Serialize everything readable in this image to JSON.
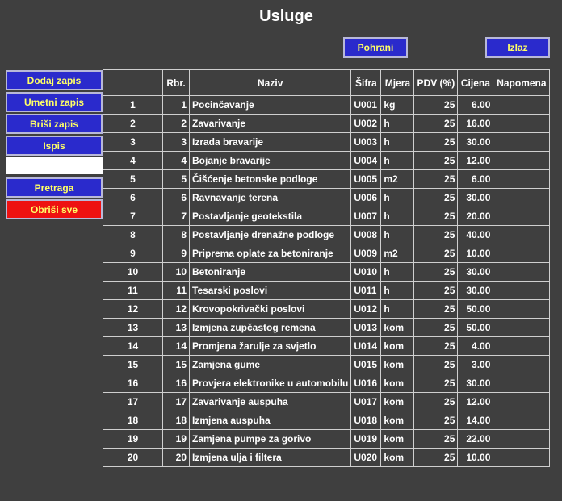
{
  "page": {
    "title": "Usluge"
  },
  "toolbar": {
    "save_label": "Pohrani",
    "exit_label": "Izlaz"
  },
  "sidebar": {
    "add_label": "Dodaj zapis",
    "insert_label": "Umetni zapis",
    "delete_label": "Briši zapis",
    "print_label": "Ispis",
    "search_value": "",
    "search_label": "Pretraga",
    "delete_all_label": "Obriši sve"
  },
  "colors": {
    "button_bg": "#2a2acc",
    "button_text": "#ffff66",
    "danger_bg": "#ee1111",
    "background": "#3f3f3f"
  },
  "table": {
    "headers": [
      "",
      "Rbr.",
      "Naziv",
      "Šifra",
      "Mjera",
      "PDV (%)",
      "Cijena",
      "Napomena"
    ],
    "rows": [
      [
        "1",
        "1",
        "Pocinčavanje",
        "U001",
        "kg",
        "25",
        "6.00",
        ""
      ],
      [
        "2",
        "2",
        "Zavarivanje",
        "U002",
        "h",
        "25",
        "16.00",
        ""
      ],
      [
        "3",
        "3",
        "Izrada bravarije",
        "U003",
        "h",
        "25",
        "30.00",
        ""
      ],
      [
        "4",
        "4",
        "Bojanje bravarije",
        "U004",
        "h",
        "25",
        "12.00",
        ""
      ],
      [
        "5",
        "5",
        "Čišćenje betonske podloge",
        "U005",
        "m2",
        "25",
        "6.00",
        ""
      ],
      [
        "6",
        "6",
        "Ravnavanje terena",
        "U006",
        "h",
        "25",
        "30.00",
        ""
      ],
      [
        "7",
        "7",
        "Postavljanje geotekstila",
        "U007",
        "h",
        "25",
        "20.00",
        ""
      ],
      [
        "8",
        "8",
        "Postavljanje drenažne podloge",
        "U008",
        "h",
        "25",
        "40.00",
        ""
      ],
      [
        "9",
        "9",
        "Priprema oplate za betoniranje",
        "U009",
        "m2",
        "25",
        "10.00",
        ""
      ],
      [
        "10",
        "10",
        "Betoniranje",
        "U010",
        "h",
        "25",
        "30.00",
        ""
      ],
      [
        "11",
        "11",
        "Tesarski poslovi",
        "U011",
        "h",
        "25",
        "30.00",
        ""
      ],
      [
        "12",
        "12",
        "Krovopokrivački poslovi",
        "U012",
        "h",
        "25",
        "50.00",
        ""
      ],
      [
        "13",
        "13",
        "Izmjena zupčastog remena",
        "U013",
        "kom",
        "25",
        "50.00",
        ""
      ],
      [
        "14",
        "14",
        "Promjena žarulje za svjetlo",
        "U014",
        "kom",
        "25",
        "4.00",
        ""
      ],
      [
        "15",
        "15",
        "Zamjena gume",
        "U015",
        "kom",
        "25",
        "3.00",
        ""
      ],
      [
        "16",
        "16",
        "Provjera elektronike u automobilu",
        "U016",
        "kom",
        "25",
        "30.00",
        ""
      ],
      [
        "17",
        "17",
        "Zavarivanje auspuha",
        "U017",
        "kom",
        "25",
        "12.00",
        ""
      ],
      [
        "18",
        "18",
        "Izmjena auspuha",
        "U018",
        "kom",
        "25",
        "14.00",
        ""
      ],
      [
        "19",
        "19",
        "Zamjena pumpe za gorivo",
        "U019",
        "kom",
        "25",
        "22.00",
        ""
      ],
      [
        "20",
        "20",
        "Izmjena ulja i filtera",
        "U020",
        "kom",
        "25",
        "10.00",
        ""
      ]
    ]
  }
}
